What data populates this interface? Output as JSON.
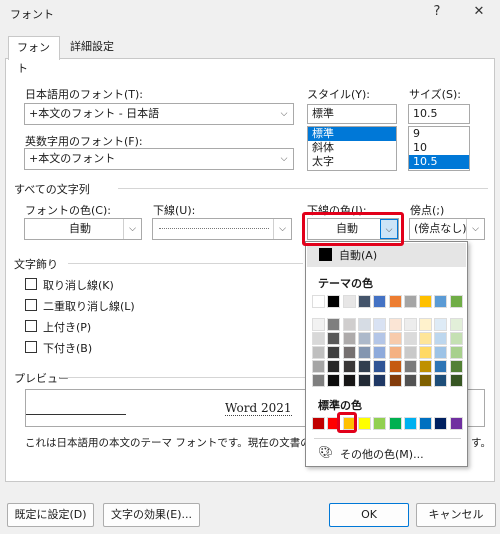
{
  "window": {
    "title": "フォント",
    "help": "?",
    "close": "✕"
  },
  "tabs": [
    "フォント",
    "詳細設定"
  ],
  "jp_font": {
    "label": "日本語用のフォント(T):",
    "value": "+本文のフォント - 日本語"
  },
  "en_font": {
    "label": "英数字用のフォント(F):",
    "value": "+本文のフォント"
  },
  "style": {
    "label": "スタイル(Y):",
    "value": "標準",
    "options": [
      "標準",
      "斜体",
      "太字"
    ],
    "selected": 0
  },
  "size": {
    "label": "サイズ(S):",
    "value": "10.5",
    "options": [
      "9",
      "10",
      "10.5"
    ],
    "selected": 2
  },
  "all_text": {
    "section": "すべての文字列",
    "font_color_label": "フォントの色(C):",
    "font_color_value": "自動",
    "underline_label": "下線(U):",
    "underline_value": "",
    "underline_color_label": "下線の色(I):",
    "underline_color_value": "自動",
    "emphasis_label": "傍点(;)",
    "emphasis_value": "(傍点なし)"
  },
  "effects": {
    "section": "文字飾り",
    "items": [
      "取り消し線(K)",
      "二重取り消し線(L)",
      "上付き(P)",
      "下付き(B)"
    ]
  },
  "preview": {
    "section": "プレビュー",
    "sample": "Word 2021",
    "note": "これは日本語用の本文のテーマ フォントです。現在の文書のテーマ",
    "note_tail": "す。"
  },
  "color_popup": {
    "auto_label": "自動(A)",
    "theme_label": "テーマの色",
    "standard_label": "標準の色",
    "more_label": "その他の色(M)...",
    "theme_colors": [
      "#ffffff",
      "#000000",
      "#e7e6e6",
      "#44546a",
      "#4472c4",
      "#ed7d31",
      "#a5a5a5",
      "#ffc000",
      "#5b9bd5",
      "#70ad47"
    ],
    "theme_shades": [
      [
        "#f2f2f2",
        "#7f7f7f",
        "#d0cece",
        "#d6dce4",
        "#d9e2f3",
        "#fbe5d5",
        "#ededed",
        "#fff2cc",
        "#deebf6",
        "#e2efd9"
      ],
      [
        "#d8d8d8",
        "#595959",
        "#aeabab",
        "#adb9ca",
        "#b4c6e7",
        "#f7cbac",
        "#dbdbdb",
        "#fee599",
        "#bdd7ee",
        "#c5e0b3"
      ],
      [
        "#bfbfbf",
        "#3f3f3f",
        "#757070",
        "#8496b0",
        "#8eaadb",
        "#f4b183",
        "#c9c9c9",
        "#ffd965",
        "#9dc3e6",
        "#a8d08d"
      ],
      [
        "#a5a5a5",
        "#262626",
        "#3a3838",
        "#323f4f",
        "#2f5496",
        "#c55a11",
        "#7b7b7b",
        "#bf9000",
        "#2e75b5",
        "#538135"
      ],
      [
        "#7f7f7f",
        "#0c0c0c",
        "#171616",
        "#222a35",
        "#1f3864",
        "#833c0b",
        "#525252",
        "#7f6000",
        "#1e4e79",
        "#375623"
      ]
    ],
    "standard_colors": [
      "#c00000",
      "#ff0000",
      "#ffc000",
      "#ffff00",
      "#92d050",
      "#00b050",
      "#00b0f0",
      "#0070c0",
      "#002060",
      "#7030a0"
    ],
    "selected_standard": 2
  },
  "buttons": {
    "default": "既定に設定(D)",
    "effects": "文字の効果(E)...",
    "ok": "OK",
    "cancel": "キャンセル"
  }
}
